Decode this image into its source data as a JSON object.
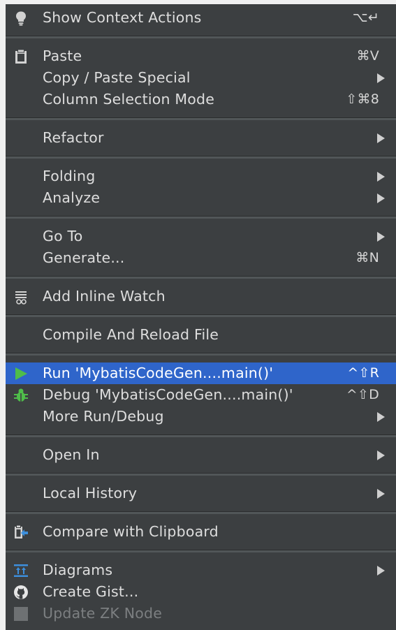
{
  "menu": {
    "items": [
      {
        "id": "show-context-actions",
        "label": "Show Context Actions",
        "shortcut": "⌥↵",
        "icon": "lightbulb-icon"
      },
      {
        "id": "paste",
        "label": "Paste",
        "shortcut": "⌘V",
        "icon": "clipboard-icon"
      },
      {
        "id": "copy-paste-special",
        "label": "Copy / Paste Special",
        "submenu": true
      },
      {
        "id": "column-selection-mode",
        "label": "Column Selection Mode",
        "shortcut": "⇧⌘8"
      },
      {
        "id": "refactor",
        "label": "Refactor",
        "submenu": true
      },
      {
        "id": "folding",
        "label": "Folding",
        "submenu": true
      },
      {
        "id": "analyze",
        "label": "Analyze",
        "submenu": true
      },
      {
        "id": "go-to",
        "label": "Go To",
        "submenu": true
      },
      {
        "id": "generate",
        "label": "Generate...",
        "shortcut": "⌘N"
      },
      {
        "id": "add-inline-watch",
        "label": "Add Inline Watch",
        "icon": "inline-watch-icon"
      },
      {
        "id": "compile-reload",
        "label": "Compile And Reload File"
      },
      {
        "id": "run",
        "label": "Run 'MybatisCodeGen....main()'",
        "shortcut": "^⇧R",
        "icon": "run-icon",
        "selected": true
      },
      {
        "id": "debug",
        "label": "Debug 'MybatisCodeGen....main()'",
        "shortcut": "^⇧D",
        "icon": "debug-icon"
      },
      {
        "id": "more-run-debug",
        "label": "More Run/Debug",
        "submenu": true
      },
      {
        "id": "open-in",
        "label": "Open In",
        "submenu": true
      },
      {
        "id": "local-history",
        "label": "Local History",
        "submenu": true
      },
      {
        "id": "compare-clipboard",
        "label": "Compare with Clipboard",
        "icon": "compare-clipboard-icon"
      },
      {
        "id": "diagrams",
        "label": "Diagrams",
        "submenu": true,
        "icon": "diagrams-icon"
      },
      {
        "id": "create-gist",
        "label": "Create Gist...",
        "icon": "github-icon"
      },
      {
        "id": "update-zk-node",
        "label": "Update ZK Node",
        "icon": "zk-node-icon",
        "disabled": true
      }
    ]
  },
  "colors": {
    "menu_bg": "#3c3f41",
    "selection": "#2f65ca",
    "text": "#dedede",
    "run_green": "#4fbd4a"
  }
}
